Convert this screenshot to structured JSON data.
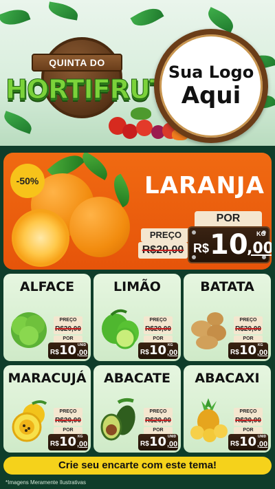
{
  "header": {
    "title_top": "QUINTA DO",
    "title_main": "HORTIFRUTI",
    "logo_line1": "Sua Logo",
    "logo_line2": "Aqui"
  },
  "featured": {
    "discount": "-50%",
    "name": "LARANJA",
    "price_label": "PREÇO",
    "old_price": "R$20,00",
    "por_label": "POR",
    "currency": "R$",
    "price_int": "10",
    "price_dec": ",00",
    "unit": "KG"
  },
  "products": [
    {
      "name": "ALFACE",
      "price_label": "PREÇO",
      "old_price": "R$20,00",
      "por_label": "POR",
      "currency": "R$",
      "price_int": "10",
      "price_dec": ",00",
      "unit": "UNID"
    },
    {
      "name": "LIMÃO",
      "price_label": "PREÇO",
      "old_price": "R$20,00",
      "por_label": "POR",
      "currency": "R$",
      "price_int": "10",
      "price_dec": ",00",
      "unit": "KG"
    },
    {
      "name": "BATATA",
      "price_label": "PREÇO",
      "old_price": "R$20,00",
      "por_label": "POR",
      "currency": "R$",
      "price_int": "10",
      "price_dec": ",00",
      "unit": "KG"
    },
    {
      "name": "MARACUJÁ",
      "price_label": "PREÇO",
      "old_price": "R$20,00",
      "por_label": "POR",
      "currency": "R$",
      "price_int": "10",
      "price_dec": ",00",
      "unit": "KG"
    },
    {
      "name": "ABACATE",
      "price_label": "PREÇO",
      "old_price": "R$20,00",
      "por_label": "POR",
      "currency": "R$",
      "price_int": "10",
      "price_dec": ",00",
      "unit": "UNID"
    },
    {
      "name": "ABACAXI",
      "price_label": "PREÇO",
      "old_price": "R$20,00",
      "por_label": "POR",
      "currency": "R$",
      "price_int": "10",
      "price_dec": ",00",
      "unit": "UNID"
    }
  ],
  "cta": "Crie seu encarte com este tema!",
  "disclaimer": "*Imagens Meramente Ilustrativas",
  "colors": {
    "featured_bg": "#ee6410",
    "cta_bg": "#f5d21b",
    "price_box": "#2b180a",
    "background": "#0f3d2a"
  }
}
